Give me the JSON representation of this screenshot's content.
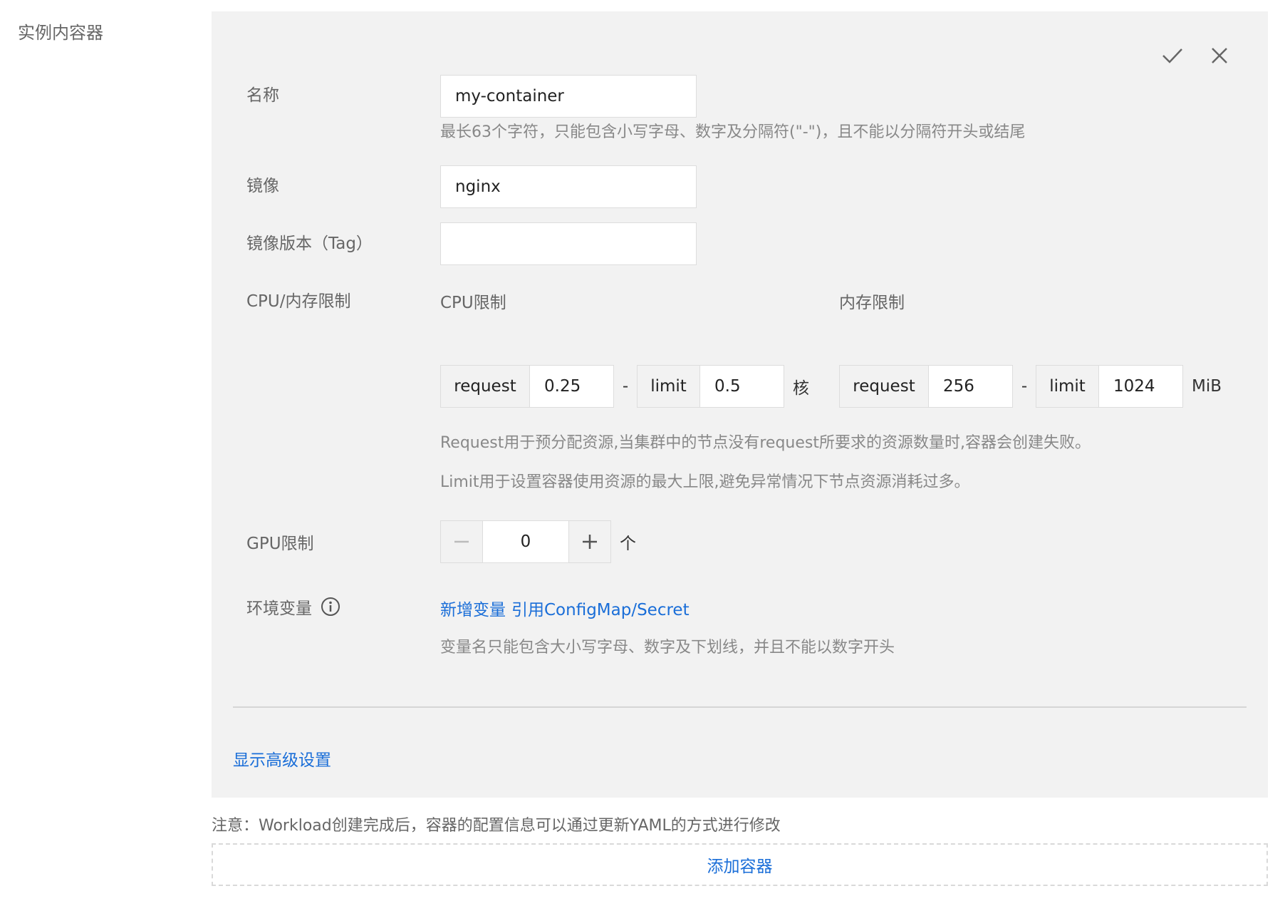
{
  "section": {
    "label": "实例内容器"
  },
  "panel": {
    "actions": {
      "confirm_icon": "check-icon",
      "close_icon": "close-icon"
    },
    "name": {
      "label": "名称",
      "value": "my-container",
      "hint": "最长63个字符，只能包含小写字母、数字及分隔符(\"-\")，且不能以分隔符开头或结尾"
    },
    "image": {
      "label": "镜像",
      "value": "nginx"
    },
    "tag": {
      "label": "镜像版本（Tag）",
      "value": ""
    },
    "resources": {
      "label": "CPU/内存限制",
      "cpu": {
        "label": "CPU限制",
        "request_label": "request",
        "request": "0.25",
        "sep": "-",
        "limit_label": "limit",
        "limit": "0.5",
        "unit": "核"
      },
      "memory": {
        "label": "内存限制",
        "request_label": "request",
        "request": "256",
        "sep": "-",
        "limit_label": "limit",
        "limit": "1024",
        "unit": "MiB"
      },
      "hint_request": "Request用于预分配资源,当集群中的节点没有request所要求的资源数量时,容器会创建失败。",
      "hint_limit": "Limit用于设置容器使用资源的最大上限,避免异常情况下节点资源消耗过多。"
    },
    "gpu": {
      "label": "GPU限制",
      "value": "0",
      "unit": "个"
    },
    "env": {
      "label": "环境变量",
      "info_icon": "info-icon",
      "add_link": "新增变量",
      "ref_link": "引用ConfigMap/Secret",
      "hint": "变量名只能包含大小写字母、数字及下划线，并且不能以数字开头"
    },
    "advanced_link": "显示高级设置"
  },
  "note": "注意：Workload创建完成后，容器的配置信息可以通过更新YAML的方式进行修改",
  "add_container": "添加容器",
  "colors": {
    "link": "#1a6ed8",
    "panel_bg": "#f2f2f2"
  }
}
